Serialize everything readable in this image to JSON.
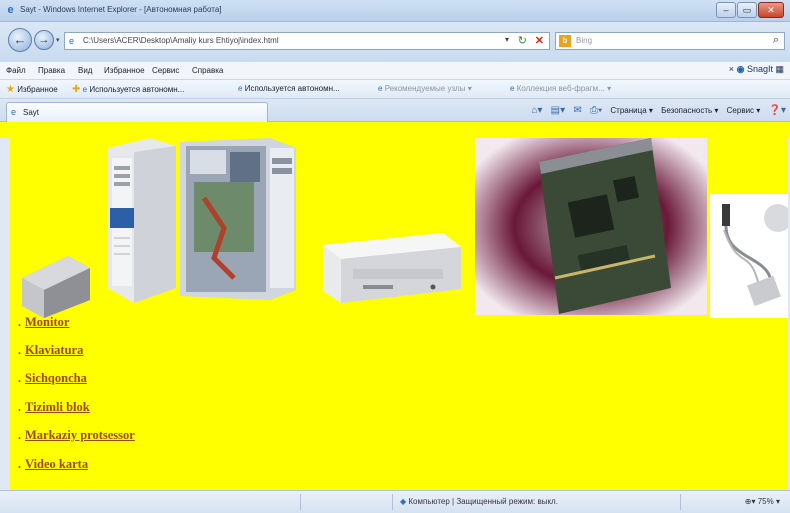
{
  "window": {
    "title": "Sayt - Windows Internet Explorer - [Автономная работа]",
    "buttons": [
      "–",
      "▭",
      "✕"
    ]
  },
  "address": {
    "url": "C:\\Users\\ACER\\Desktop\\Amaliy kurs Ehtiyoj\\index.html",
    "search_placeholder": "Bing"
  },
  "menu": {
    "items": [
      "Файл",
      "Правка",
      "Вид",
      "Избранное",
      "Сервис",
      "Справка"
    ],
    "snagit": "SnagIt"
  },
  "favorites": {
    "label": "Избранное",
    "items": [
      "Используется автономн...",
      "Используется автономн...",
      "Рекомендуемые узлы ▾",
      "Коллекция веб-фрагм... ▾"
    ]
  },
  "tab": {
    "label": "Sayt"
  },
  "command_bar": {
    "items": [
      "Страница ▾",
      "Безопасность ▾",
      "Сервис ▾"
    ]
  },
  "links": [
    "Monitor",
    "Klaviatura",
    "Sichqoncha",
    "Tizimli blok",
    "Markaziy protsessor",
    "Video karta"
  ],
  "status": {
    "zone": "Компьютер | Защищенный режим: выкл.",
    "zoom": "75%"
  },
  "colors": {
    "page_background": "#ffff00",
    "link": "#9b4a10"
  },
  "images": [
    "floppy-drive",
    "system-unit-tower",
    "open-computer-case",
    "dvd-drive",
    "expansion-card",
    "usb-device"
  ]
}
